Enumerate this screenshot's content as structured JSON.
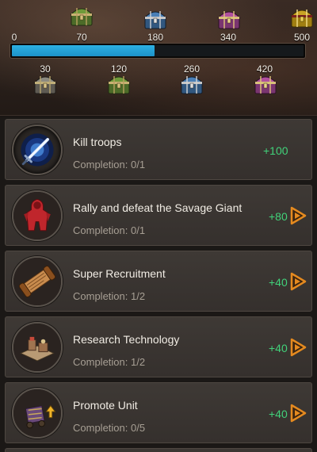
{
  "activity": {
    "progress_fraction": 0.4872,
    "milestones_top": [
      {
        "label": "0",
        "chest": "none"
      },
      {
        "label": "70",
        "chest": "green-chest-icon"
      },
      {
        "label": "180",
        "chest": "blue-chest-icon"
      },
      {
        "label": "340",
        "chest": "purple-chest-icon"
      },
      {
        "label": "500",
        "chest": "gold-chest-icon"
      }
    ],
    "milestones_bottom": [
      {
        "label": "30",
        "chest": "gray-chest-icon"
      },
      {
        "label": "120",
        "chest": "green-chest-icon"
      },
      {
        "label": "260",
        "chest": "blue-chest-icon"
      },
      {
        "label": "420",
        "chest": "purple-chest-icon"
      }
    ]
  },
  "tasks": [
    {
      "title": "Kill troops",
      "progress": "Completion: 0/1",
      "reward": "+100",
      "icon": "sword-icon",
      "has_go_arrow": false
    },
    {
      "title": "Rally and defeat the Savage Giant",
      "progress": "Completion: 0/1",
      "reward": "+80",
      "icon": "savage-giant-icon",
      "has_go_arrow": true
    },
    {
      "title": "Super Recruitment",
      "progress": "Completion: 1/2",
      "reward": "+40",
      "icon": "scroll-icon",
      "has_go_arrow": true
    },
    {
      "title": "Research Technology",
      "progress": "Completion: 1/2",
      "reward": "+40",
      "icon": "research-building-icon",
      "has_go_arrow": true
    },
    {
      "title": "Promote Unit",
      "progress": "Completion: 0/5",
      "reward": "+40",
      "icon": "promote-unit-icon",
      "has_go_arrow": true
    }
  ],
  "colors": {
    "progress_fill": "#1d92c8",
    "reward_text": "#41d27a",
    "go_arrow": "#e58a1f",
    "chest_green": "#6f9a3a",
    "chest_blue": "#4a7fb6",
    "chest_purple": "#b0509e",
    "chest_gold": "#c9a324",
    "chest_gray": "#8c8a80"
  }
}
